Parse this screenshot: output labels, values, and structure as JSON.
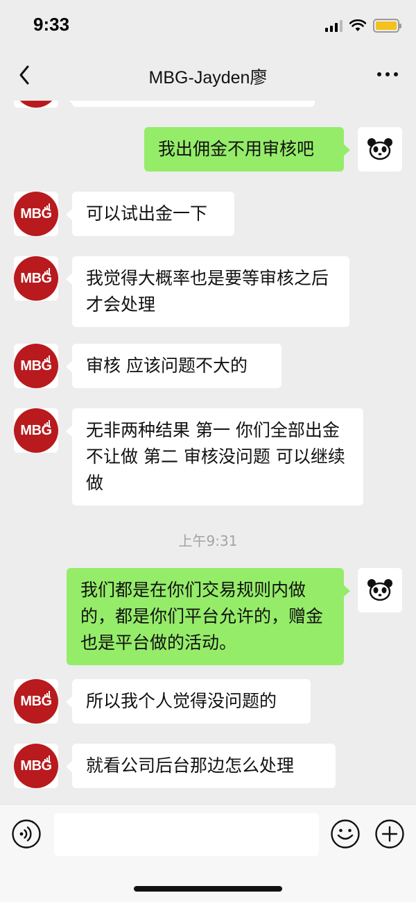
{
  "status_bar": {
    "time": "9:33"
  },
  "nav": {
    "title": "MBG-Jayden廖"
  },
  "avatar": {
    "contact_text": "MBG"
  },
  "messages": [
    {
      "text": "我出佣金不用审核吧",
      "side": "right"
    },
    {
      "text": "可以试出金一下",
      "side": "left"
    },
    {
      "text": "我觉得大概率也是要等审核之后 才会处理",
      "side": "left"
    },
    {
      "text": "审核 应该问题不大的",
      "side": "left"
    },
    {
      "text": "无非两种结果  第一 你们全部出金不让做  第二 审核没问题 可以继续做",
      "side": "left"
    },
    {
      "text": "我们都是在你们交易规则内做的，都是你们平台允许的，赠金也是平台做的活动。",
      "side": "right"
    },
    {
      "text": "所以我个人觉得没问题的",
      "side": "left"
    },
    {
      "text": "就看公司后台那边怎么处理",
      "side": "left"
    }
  ],
  "timestamp": "上午9:31",
  "colors": {
    "sent_bubble": "#95ec69",
    "received_bubble": "#ffffff",
    "background": "#ededed",
    "avatar_red": "#b81a1d"
  },
  "icons": [
    "back-icon",
    "more-icon",
    "voice-icon",
    "emoji-icon",
    "plus-icon",
    "panda-avatar-icon"
  ]
}
